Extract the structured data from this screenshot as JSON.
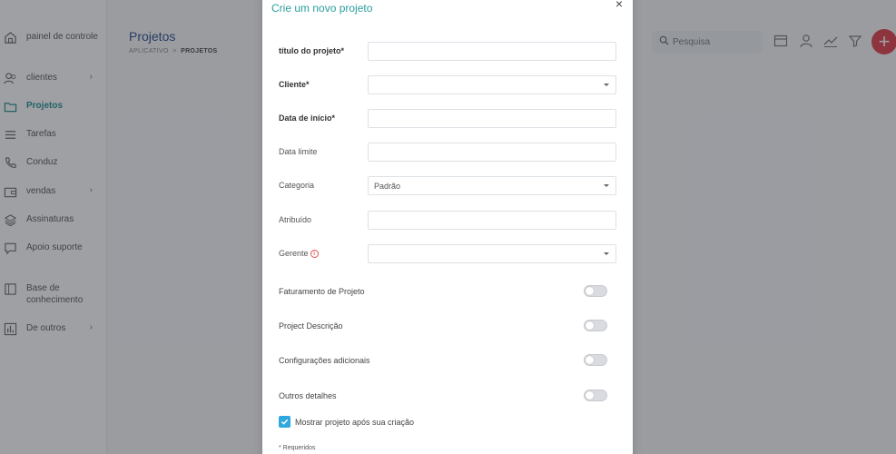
{
  "sidebar": {
    "items": [
      {
        "label": "painel de controle",
        "icon": "home-icon"
      },
      {
        "label": "clientes",
        "icon": "users-icon",
        "chevron": "›"
      },
      {
        "label": "Projetos",
        "icon": "folder-icon",
        "active": true
      },
      {
        "label": "Tarefas",
        "icon": "list-icon"
      },
      {
        "label": "Conduz",
        "icon": "phone-icon"
      },
      {
        "label": "vendas",
        "icon": "wallet-icon",
        "chevron": "›"
      },
      {
        "label": "Assinaturas",
        "icon": "layers-icon"
      },
      {
        "label": "Apoio suporte",
        "icon": "chat-icon"
      },
      {
        "label": "Base de conhecimento",
        "icon": "book-icon"
      },
      {
        "label": "De outros",
        "icon": "chart-icon",
        "chevron": "›"
      }
    ]
  },
  "header": {
    "title": "Projetos",
    "breadcrumb_root": "APLICATIVO",
    "breadcrumb_sep": ">",
    "breadcrumb_current": "PROJETOS",
    "search_placeholder": "Pesquisa",
    "fab_label": "+"
  },
  "modal": {
    "title": "Crie um novo projeto",
    "close": "×",
    "fields": {
      "title": {
        "label": "título do projeto*",
        "value": ""
      },
      "client": {
        "label": "Cliente*",
        "value": ""
      },
      "start": {
        "label": "Data de início*",
        "value": ""
      },
      "deadline": {
        "label": "Data limite",
        "value": ""
      },
      "category": {
        "label": "Categoria",
        "value": "Padrão"
      },
      "assigned": {
        "label": "Atribuído",
        "value": ""
      },
      "manager": {
        "label": "Gerente",
        "value": "",
        "info": "i"
      }
    },
    "toggles": {
      "billing": {
        "label": "Faturamento de Projeto",
        "on": false
      },
      "description": {
        "label": "Project Descrição",
        "on": false
      },
      "settings": {
        "label": "Configurações adicionais",
        "on": false
      },
      "other": {
        "label": "Outros detalhes",
        "on": false
      }
    },
    "show_after": {
      "label": "Mostrar projeto após sua criação",
      "checked": true
    },
    "required_note": "* Requeridos"
  },
  "colors": {
    "accent": "#2a9d9d",
    "checkbox": "#2fa8e0",
    "fab": "#e23b4a",
    "title_blue": "#2b4a8b"
  }
}
